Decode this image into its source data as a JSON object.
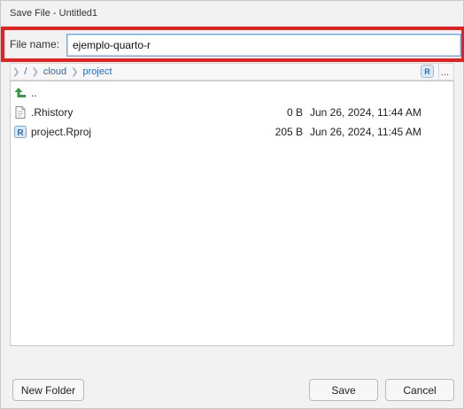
{
  "window": {
    "title": "Save File - Untitled1"
  },
  "filename": {
    "label": "File name:",
    "value": "ejemplo-quarto-r"
  },
  "breadcrumb": {
    "root": "/",
    "items": [
      "cloud",
      "project"
    ],
    "project_icon": "R",
    "more": "..."
  },
  "files": [
    {
      "name": "..",
      "size": "",
      "modified": "",
      "icon": "up-arrow-icon"
    },
    {
      "name": ".Rhistory",
      "size": "0 B",
      "modified": "Jun 26, 2024, 11:44 AM",
      "icon": "text-file-icon"
    },
    {
      "name": "project.Rproj",
      "size": "205 B",
      "modified": "Jun 26, 2024, 11:45 AM",
      "icon": "r-project-icon"
    }
  ],
  "buttons": {
    "new_folder": "New Folder",
    "save": "Save",
    "cancel": "Cancel"
  },
  "colors": {
    "highlight": "#e4211e",
    "link": "#2a67b1",
    "up_arrow": "#2e9e43",
    "focus_border": "#7aa7e0"
  }
}
